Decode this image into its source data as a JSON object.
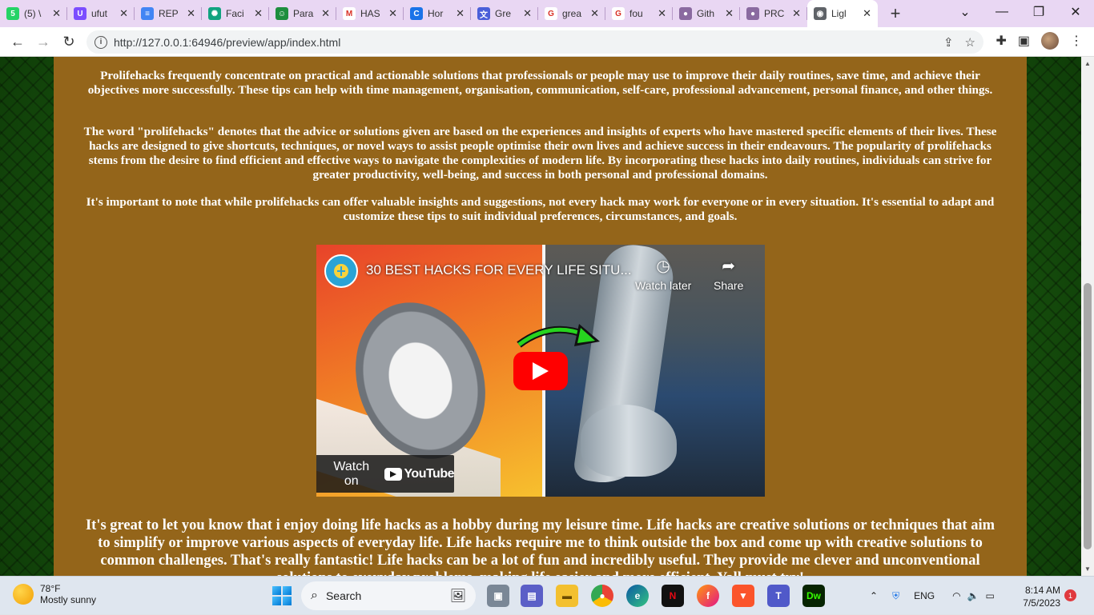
{
  "browser": {
    "tabs": [
      {
        "label": "(5) \\",
        "favicon": "whatsapp-icon",
        "color": "#25d366",
        "glyph": "5"
      },
      {
        "label": "ufut",
        "favicon": "ufuk-icon",
        "color": "#7c4dff",
        "glyph": "U"
      },
      {
        "label": "REP",
        "favicon": "docs-icon",
        "color": "#4285f4",
        "glyph": "≡"
      },
      {
        "label": "Faci",
        "favicon": "openai-icon",
        "color": "#10a37f",
        "glyph": "✺"
      },
      {
        "label": "Para",
        "favicon": "bot-icon",
        "color": "#1e8e3e",
        "glyph": "☺"
      },
      {
        "label": "HAS",
        "favicon": "gmail-icon",
        "color": "#ffffff",
        "glyph": "M"
      },
      {
        "label": "Hor",
        "favicon": "copilot-icon",
        "color": "#1a73e8",
        "glyph": "C"
      },
      {
        "label": "Gre",
        "favicon": "translate-icon",
        "color": "#4a5fd9",
        "glyph": "文"
      },
      {
        "label": "grea",
        "favicon": "google-icon",
        "color": "#ffffff",
        "glyph": "G"
      },
      {
        "label": "fou",
        "favicon": "google-icon",
        "color": "#ffffff",
        "glyph": "G"
      },
      {
        "label": "Gith",
        "favicon": "github-icon",
        "color": "#8a6aa0",
        "glyph": "●"
      },
      {
        "label": "PRC",
        "favicon": "github-icon",
        "color": "#8a6aa0",
        "glyph": "●"
      },
      {
        "label": "Ligl",
        "favicon": "globe-icon",
        "color": "#5f6368",
        "glyph": "◉",
        "active": true
      }
    ],
    "url": "http://127.0.0.1:64946/preview/app/index.html"
  },
  "page": {
    "paragraph1": "Prolifehacks frequently concentrate on practical and actionable solutions that professionals or people may use to improve their daily routines, save time, and achieve their objectives more successfully. These tips can help with time management, organisation, communication, self-care, professional advancement, personal finance, and other things.",
    "paragraph2": "The word \"prolifehacks\" denotes that the advice or solutions given are based on the experiences and insights of experts who have mastered specific elements of their lives. These hacks are designed to give shortcuts, techniques, or novel ways to assist people optimise their own lives and achieve success in their endeavours. The popularity of prolifehacks stems from the desire to find efficient and effective ways to navigate the complexities of modern life. By incorporating these hacks into daily routines, individuals can strive for greater productivity, well-being, and success in both personal and professional domains.",
    "paragraph3": "It's important to note that while prolifehacks can offer valuable insights and suggestions, not every hack may work for everyone or in every situation. It's essential to adapt and customize these tips to suit individual preferences, circumstances, and goals.",
    "video": {
      "title": "30 BEST HACKS FOR EVERY LIFE SITU...",
      "watch_later": "Watch later",
      "share": "Share",
      "watch_on": "Watch on",
      "youtube": "YouTube"
    },
    "paragraph4": "It's great to let you know that i enjoy doing life hacks as a hobby during my leisure time. Life hacks are creative solutions or techniques that aim to simplify or improve various aspects of everyday life. Life hacks require me to think outside the box and come up with creative solutions to common challenges. That's really fantastic! Life hacks can be a lot of fun and incredibly useful. They provide me clever and unconventional solutions to everyday problems, making life easier and more efficient. Yall must try!"
  },
  "taskbar": {
    "weather_temp": "78°F",
    "weather_desc": "Mostly sunny",
    "search_label": "Search",
    "language": "ENG",
    "time": "8:14 AM",
    "date": "7/5/2023",
    "notification_count": "1"
  }
}
